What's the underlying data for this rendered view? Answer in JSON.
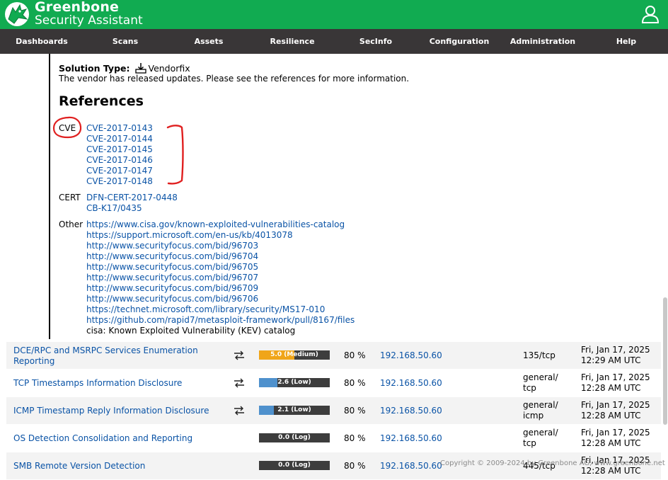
{
  "header": {
    "brand_line1": "Greenbone",
    "brand_line2": "Security Assistant",
    "colors": {
      "header_bg": "#11ab51",
      "nav_bg": "#393637"
    }
  },
  "nav": [
    "Dashboards",
    "Scans",
    "Assets",
    "Resilience",
    "SecInfo",
    "Configuration",
    "Administration",
    "Help"
  ],
  "solution": {
    "label": "Solution Type:",
    "type": "Vendorfix",
    "description": "The vendor has released updates. Please see the references for more information."
  },
  "references": {
    "title": "References",
    "cve_label": "CVE",
    "cves": [
      "CVE-2017-0143",
      "CVE-2017-0144",
      "CVE-2017-0145",
      "CVE-2017-0146",
      "CVE-2017-0147",
      "CVE-2017-0148"
    ],
    "cert_label": "CERT",
    "certs": [
      "DFN-CERT-2017-0448",
      "CB-K17/0435"
    ],
    "other_label": "Other",
    "others": [
      "https://www.cisa.gov/known-exploited-vulnerabilities-catalog",
      "https://support.microsoft.com/en-us/kb/4013078",
      "http://www.securityfocus.com/bid/96703",
      "http://www.securityfocus.com/bid/96704",
      "http://www.securityfocus.com/bid/96705",
      "http://www.securityfocus.com/bid/96707",
      "http://www.securityfocus.com/bid/96709",
      "http://www.securityfocus.com/bid/96706",
      "https://technet.microsoft.com/library/security/MS17-010",
      "https://github.com/rapid7/metasploit-framework/pull/8167/files"
    ],
    "kev_note": "cisa: Known Exploited Vulnerability (KEV) catalog"
  },
  "results": [
    {
      "name_l1": "DCE/RPC and MSRPC Services Enumeration",
      "name_l2": "Reporting",
      "delta_icon": "swap-arrows-icon",
      "severity_label": "5.0 (Medium)",
      "severity": 5.0,
      "severity_color": "#f0a519",
      "qod": "80 %",
      "host": "192.168.50.60",
      "port_l1": "135/tcp",
      "port_l2": "",
      "date_l1": "Fri, Jan 17, 2025",
      "date_l2": "12:29 AM UTC"
    },
    {
      "name_l1": "TCP Timestamps Information Disclosure",
      "name_l2": "",
      "delta_icon": "swap-arrows-icon",
      "severity_label": "2.6 (Low)",
      "severity": 2.6,
      "severity_color": "#4f91cd",
      "qod": "80 %",
      "host": "192.168.50.60",
      "port_l1": "general/",
      "port_l2": "tcp",
      "date_l1": "Fri, Jan 17, 2025",
      "date_l2": "12:28 AM UTC"
    },
    {
      "name_l1": "ICMP Timestamp Reply Information Disclosure",
      "name_l2": "",
      "delta_icon": "swap-arrows-icon",
      "severity_label": "2.1 (Low)",
      "severity": 2.1,
      "severity_color": "#4f91cd",
      "qod": "80 %",
      "host": "192.168.50.60",
      "port_l1": "general/",
      "port_l2": "icmp",
      "date_l1": "Fri, Jan 17, 2025",
      "date_l2": "12:28 AM UTC"
    },
    {
      "name_l1": "OS Detection Consolidation and Reporting",
      "name_l2": "",
      "delta_icon": "",
      "severity_label": "0.0 (Log)",
      "severity": 0.0,
      "severity_color": "#3d3d3d",
      "qod": "80 %",
      "host": "192.168.50.60",
      "port_l1": "general/",
      "port_l2": "tcp",
      "date_l1": "Fri, Jan 17, 2025",
      "date_l2": "12:28 AM UTC"
    },
    {
      "name_l1": "SMB Remote Version Detection",
      "name_l2": "",
      "delta_icon": "",
      "severity_label": "0.0 (Log)",
      "severity": 0.0,
      "severity_color": "#3d3d3d",
      "qod": "80 %",
      "host": "192.168.50.60",
      "port_l1": "445/tcp",
      "port_l2": "",
      "date_l1": "Fri, Jan 17, 2025",
      "date_l2": "12:28 AM UTC"
    }
  ],
  "footer": {
    "copyright": "Copyright © 2009-2024 by Greenbone AG, www.greenbone.net"
  }
}
